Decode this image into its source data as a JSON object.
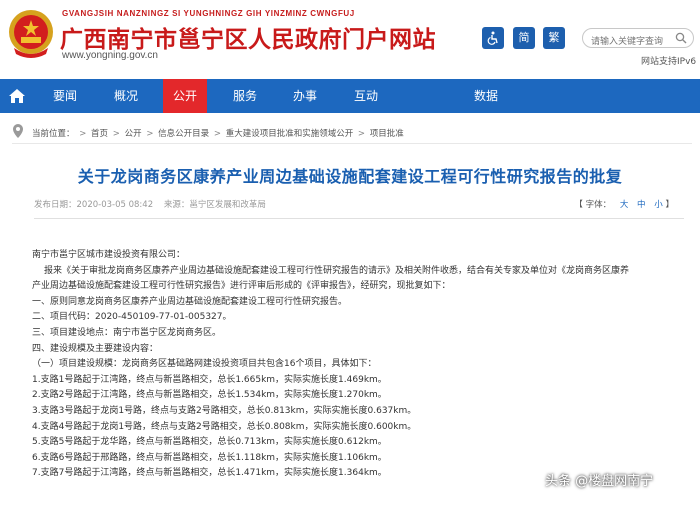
{
  "header": {
    "site_pinyin": "GVANGJSIH NANZNINGZ SI YUNGHNINGZ GIH YINZMINZ CWNGFUJ",
    "site_title": "广西南宁市邕宁区人民政府门户网站",
    "site_url": "www.yongning.gov.cn",
    "simplified_label": "简",
    "traditional_label": "繁",
    "search_placeholder": "请输入关键字查询",
    "ipv6_label": "网站支持IPv6",
    "brand_color": "#c81a1a"
  },
  "nav": {
    "items": [
      {
        "label": "要闻",
        "active": false
      },
      {
        "label": "概况",
        "active": false
      },
      {
        "label": "公开",
        "active": true
      },
      {
        "label": "服务",
        "active": false
      },
      {
        "label": "办事",
        "active": false
      },
      {
        "label": "互动",
        "active": false
      },
      {
        "label": "数据",
        "active": false
      }
    ],
    "bg_color": "#1d68bf",
    "active_color": "#e3282b"
  },
  "breadcrumb": {
    "prefix": "当前位置：",
    "items": [
      "首页",
      "公开",
      "信息公开目录",
      "重大建设项目批准和实施领域公开",
      "项目批准"
    ]
  },
  "article": {
    "title": "关于龙岗商务区康养产业周边基础设施配套建设工程可行性研究报告的批复",
    "published": "发布日期：2020-03-05 08:42",
    "source": "来源：邕宁区发展和改革局",
    "fontsize_label": "【 字体：",
    "size_large": "大",
    "size_medium": "中",
    "size_small": "小",
    "fontsize_end": "】",
    "paragraphs": [
      "南宁市邕宁区城市建设投资有限公司：",
      "报来《关于审批龙岗商务区康养产业周边基础设施配套建设工程可行性研究报告的请示》及相关附件收悉，结合有关专家及单位对《龙岗商务区康养",
      "产业周边基础设施配套建设工程可行性研究报告》进行评审后形成的《评审报告》，经研究，现批复如下：",
      "一、原则同意龙岗商务区康养产业周边基础设施配套建设工程可行性研究报告。",
      "二、项目代码：2020-450109-77-01-005327。",
      "三、项目建设地点：南宁市邕宁区龙岗商务区。",
      "四、建设规模及主要建设内容：",
      "（一）项目建设规模：龙岗商务区基础路网建设投资项目共包含16个项目，具体如下：",
      "1.支路1号路起于江湾路，终点与新邕路相交，总长1.665km，实际实施长度1.469km。",
      "2.支路2号路起于江湾路，终点与新邕路相交，总长1.534km，实际实施长度1.270km。",
      "3.支路3号路起于龙岗1号路，终点与支路2号路相交，总长0.813km，实际实施长度0.637km。",
      "4.支路4号路起于龙岗1号路，终点与支路2号路相交，总长0.808km，实际实施长度0.600km。",
      "5.支路5号路起于龙华路，终点与新邕路相交，总长0.713km，实际实施长度0.612km。",
      "6.支路6号路起于邢路路，终点与新邕路相交，总长1.118km，实际实施长度1.106km。",
      "7.支路7号路起于江湾路，终点与新邕路相交，总长1.471km，实际实施长度1.364km。"
    ]
  },
  "watermark": "头条 @楼盘网南宁"
}
